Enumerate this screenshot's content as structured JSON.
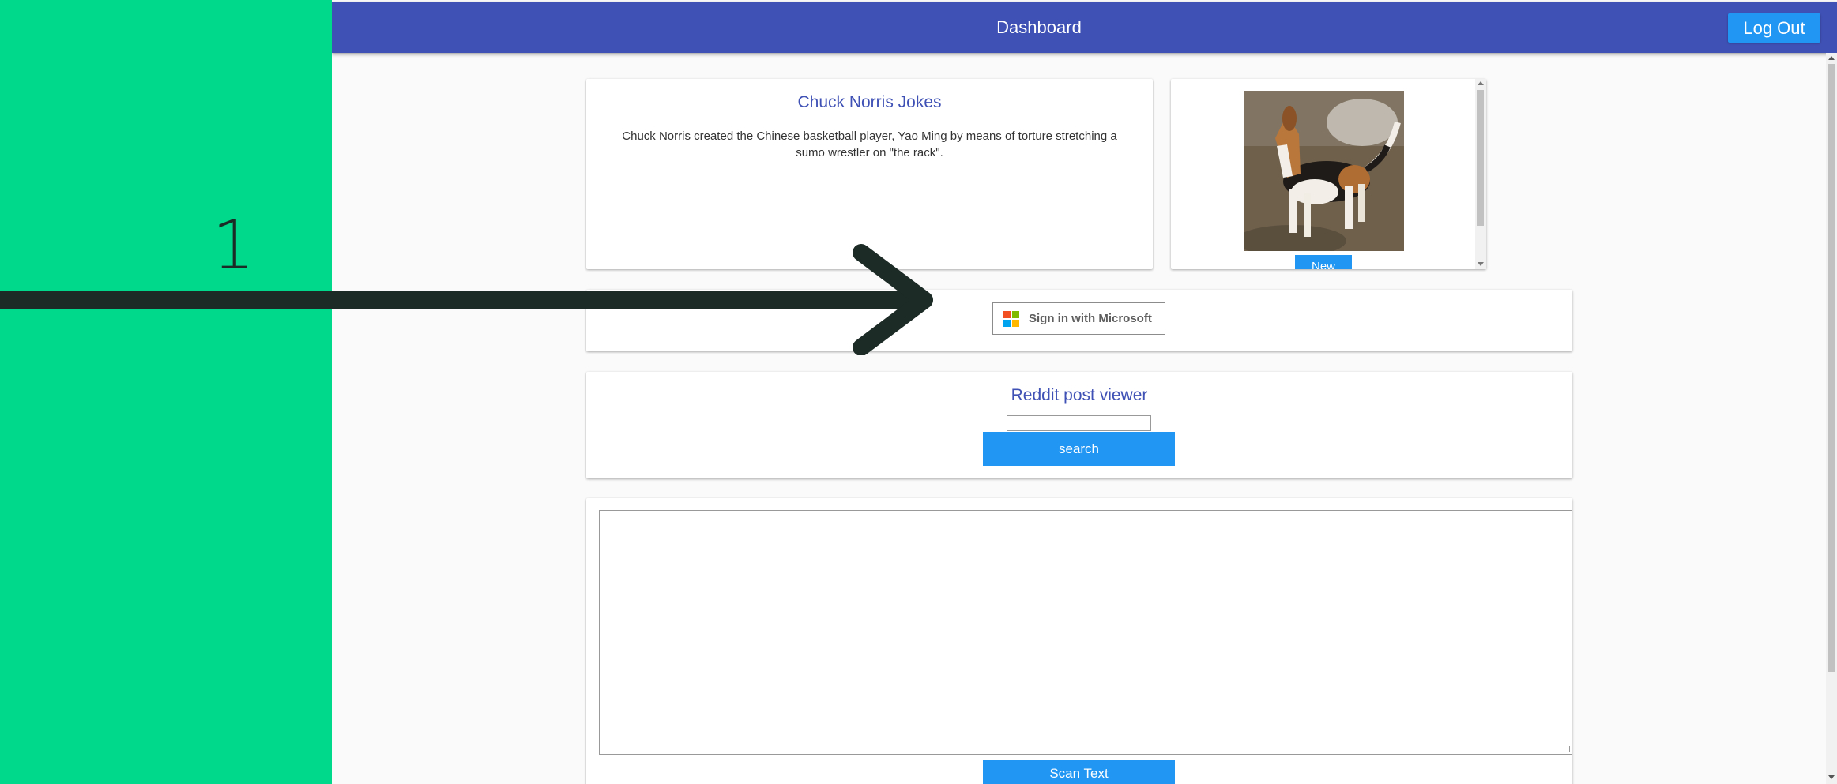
{
  "overlay": {
    "step_number": "1",
    "arrow_color": "#1d2b27",
    "background_color": "#00d98b"
  },
  "header": {
    "title": "Dashboard",
    "logout_label": "Log Out",
    "bar_color": "#3f51b5",
    "accent_color": "#2196f3"
  },
  "jokes_card": {
    "title": "Chuck Norris Jokes",
    "joke": "Chuck Norris created the Chinese basketball player, Yao Ming by means of torture stretching a sumo wrestler on \"the rack\"."
  },
  "dog_card": {
    "image_icon": "beagle-dog-photo",
    "new_label": "New"
  },
  "microsoft_card": {
    "sign_in_label": "Sign in with Microsoft",
    "logo_icon": "microsoft-logo-icon"
  },
  "reddit_card": {
    "title": "Reddit post viewer",
    "input_value": "",
    "search_label": "search"
  },
  "scan_card": {
    "textarea_value": "",
    "scan_label": "Scan Text"
  }
}
